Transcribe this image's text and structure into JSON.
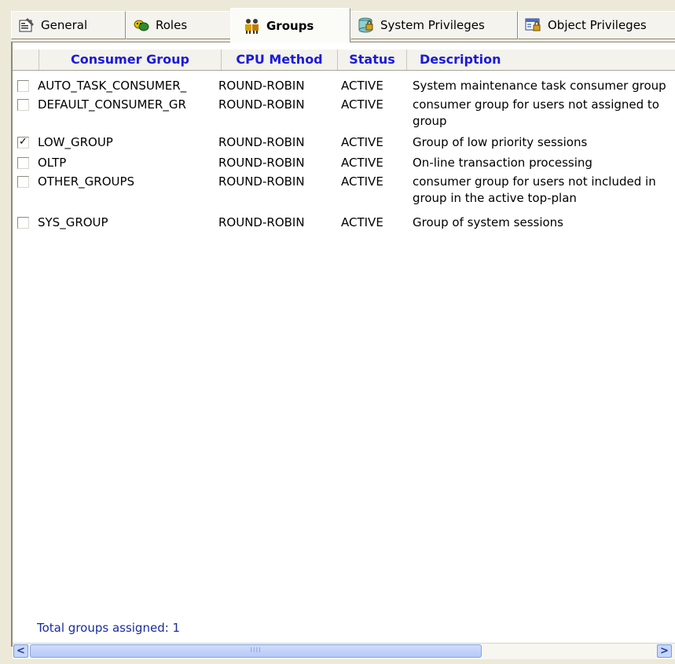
{
  "tabs": [
    {
      "label": "General",
      "icon": "general-properties-icon",
      "active": false
    },
    {
      "label": "Roles",
      "icon": "roles-icon",
      "active": false
    },
    {
      "label": "Groups",
      "icon": "groups-icon",
      "active": true
    },
    {
      "label": "System Privileges",
      "icon": "system-privileges-icon",
      "active": false
    },
    {
      "label": "Object Privileges",
      "icon": "object-privileges-icon",
      "active": false
    }
  ],
  "table": {
    "columns": [
      "Consumer Group",
      "CPU Method",
      "Status",
      "Description"
    ],
    "rows": [
      {
        "checked": false,
        "group": "AUTO_TASK_CONSUMER_",
        "method": "ROUND-ROBIN",
        "status": "ACTIVE",
        "description": "System maintenance task consumer group"
      },
      {
        "checked": false,
        "group": "DEFAULT_CONSUMER_GR",
        "method": "ROUND-ROBIN",
        "status": "ACTIVE",
        "description": "consumer group for users not assigned to group"
      },
      {
        "checked": true,
        "group": "LOW_GROUP",
        "method": "ROUND-ROBIN",
        "status": "ACTIVE",
        "description": "Group of low priority sessions"
      },
      {
        "checked": false,
        "group": "OLTP",
        "method": "ROUND-ROBIN",
        "status": "ACTIVE",
        "description": "On-line transaction processing"
      },
      {
        "checked": false,
        "group": "OTHER_GROUPS",
        "method": "ROUND-ROBIN",
        "status": "ACTIVE",
        "description": "consumer group for users not included in group in the active top-plan"
      },
      {
        "checked": false,
        "group": "SYS_GROUP",
        "method": "ROUND-ROBIN",
        "status": "ACTIVE",
        "description": "Group of system sessions"
      }
    ]
  },
  "footer": {
    "total_label": "Total groups assigned: 1"
  },
  "scrollbar": {
    "left_arrow": "<",
    "right_arrow": ">",
    "grip": "IIII"
  },
  "colors": {
    "header_text": "#1a1adb",
    "footer_text": "#1b2c9c",
    "scroll_blue": "#c5d6fc"
  }
}
